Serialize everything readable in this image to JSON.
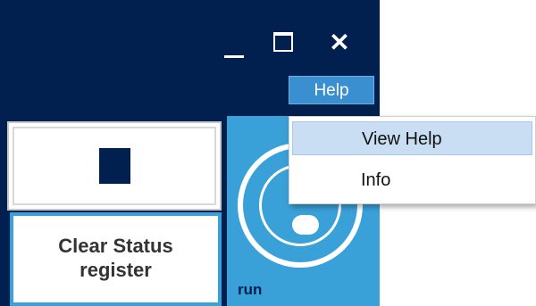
{
  "titlebar": {
    "minimize_label": "_",
    "maximize_label": "☐",
    "close_label": "✕"
  },
  "menu": {
    "help_label": "Help",
    "items": [
      {
        "label": "View Help",
        "highlighted": true
      },
      {
        "label": "Info",
        "highlighted": false
      }
    ]
  },
  "controls": {
    "stop_icon": "stop-icon",
    "clear_status_line1": "Clear Status",
    "clear_status_line2": "register",
    "run_label": "run"
  },
  "colors": {
    "window_bg": "#02204f",
    "accent": "#3aa0d8",
    "menu_highlight": "#c9def3"
  }
}
